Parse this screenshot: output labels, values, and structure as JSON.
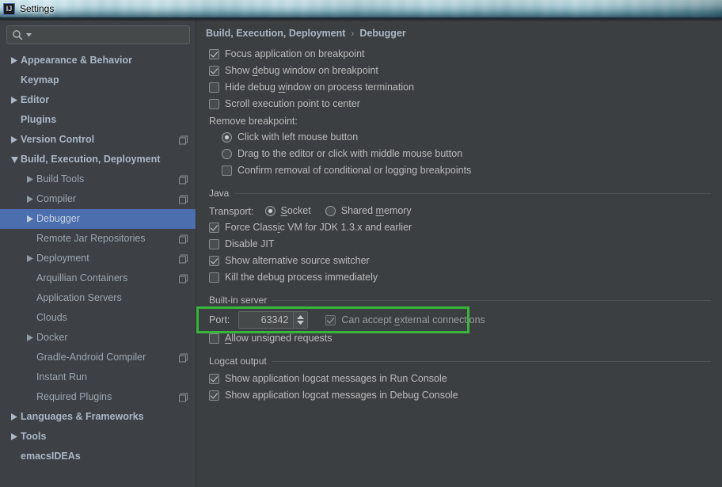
{
  "window": {
    "title": "Settings",
    "app_icon": "IJ",
    "icon_name": "intellij-idea-icon"
  },
  "sidebar": {
    "search": {
      "value": "",
      "placeholder": "",
      "icon": "search-icon",
      "dropdown_icon": "chevron-down-icon"
    },
    "items": [
      {
        "label": "Appearance & Behavior",
        "level": 0,
        "arrow": "right",
        "scope_icon": false,
        "selected": false
      },
      {
        "label": "Keymap",
        "level": 0,
        "arrow": "none",
        "scope_icon": false,
        "selected": false
      },
      {
        "label": "Editor",
        "level": 0,
        "arrow": "right",
        "scope_icon": false,
        "selected": false
      },
      {
        "label": "Plugins",
        "level": 0,
        "arrow": "none",
        "scope_icon": false,
        "selected": false
      },
      {
        "label": "Version Control",
        "level": 0,
        "arrow": "right",
        "scope_icon": true,
        "selected": false
      },
      {
        "label": "Build, Execution, Deployment",
        "level": 0,
        "arrow": "down",
        "scope_icon": false,
        "selected": false
      },
      {
        "label": "Build Tools",
        "level": 1,
        "arrow": "right",
        "scope_icon": true,
        "selected": false
      },
      {
        "label": "Compiler",
        "level": 1,
        "arrow": "right",
        "scope_icon": true,
        "selected": false
      },
      {
        "label": "Debugger",
        "level": 1,
        "arrow": "right",
        "scope_icon": false,
        "selected": true
      },
      {
        "label": "Remote Jar Repositories",
        "level": 1,
        "arrow": "none",
        "scope_icon": true,
        "selected": false
      },
      {
        "label": "Deployment",
        "level": 1,
        "arrow": "right",
        "scope_icon": true,
        "selected": false
      },
      {
        "label": "Arquillian Containers",
        "level": 1,
        "arrow": "none",
        "scope_icon": true,
        "selected": false
      },
      {
        "label": "Application Servers",
        "level": 1,
        "arrow": "none",
        "scope_icon": false,
        "selected": false
      },
      {
        "label": "Clouds",
        "level": 1,
        "arrow": "none",
        "scope_icon": false,
        "selected": false
      },
      {
        "label": "Docker",
        "level": 1,
        "arrow": "right",
        "scope_icon": false,
        "selected": false
      },
      {
        "label": "Gradle-Android Compiler",
        "level": 1,
        "arrow": "none",
        "scope_icon": true,
        "selected": false
      },
      {
        "label": "Instant Run",
        "level": 1,
        "arrow": "none",
        "scope_icon": false,
        "selected": false
      },
      {
        "label": "Required Plugins",
        "level": 1,
        "arrow": "none",
        "scope_icon": true,
        "selected": false
      },
      {
        "label": "Languages & Frameworks",
        "level": 0,
        "arrow": "right",
        "scope_icon": false,
        "selected": false
      },
      {
        "label": "Tools",
        "level": 0,
        "arrow": "right",
        "scope_icon": false,
        "selected": false
      },
      {
        "label": "emacsIDEAs",
        "level": 0,
        "arrow": "none",
        "scope_icon": false,
        "selected": false
      }
    ]
  },
  "main": {
    "breadcrumb": {
      "parent": "Build, Execution, Deployment",
      "separator": "›",
      "current": "Debugger"
    },
    "top_options": [
      {
        "label": "Focus application on breakpoint",
        "checked": true,
        "mnemonic": ""
      },
      {
        "label": "Show debug window on breakpoint",
        "checked": true,
        "mnemonic": "d"
      },
      {
        "label": "Hide debug window on process termination",
        "checked": false,
        "mnemonic": "w"
      },
      {
        "label": "Scroll execution point to center",
        "checked": false,
        "mnemonic": ""
      }
    ],
    "remove_breakpoint": {
      "title": "Remove breakpoint:",
      "radios": [
        {
          "label": "Click with left mouse button",
          "selected": true
        },
        {
          "label": "Drag to the editor or click with middle mouse button",
          "selected": false
        }
      ],
      "confirm": {
        "label": "Confirm removal of conditional or logging breakpoints",
        "checked": false
      }
    },
    "java": {
      "section_title": "Java",
      "transport": {
        "label": "Transport:",
        "options": [
          {
            "label": "Socket",
            "selected": true,
            "mnemonic": "S"
          },
          {
            "label": "Shared memory",
            "selected": false,
            "mnemonic": "m"
          }
        ]
      },
      "options": [
        {
          "label": "Force Classic VM for JDK 1.3.x and earlier",
          "checked": true,
          "mnemonic": "i"
        },
        {
          "label": "Disable JIT",
          "checked": false,
          "mnemonic": ""
        },
        {
          "label": "Show alternative source switcher",
          "checked": true,
          "mnemonic": ""
        },
        {
          "label": "Kill the debug process immediately",
          "checked": false,
          "mnemonic": ""
        }
      ]
    },
    "builtin_server": {
      "section_title": "Built-in server",
      "port_label": "Port:",
      "port_value": "63342",
      "spinner_up_icon": "spinner-up-icon",
      "spinner_down_icon": "spinner-down-icon",
      "external_connections": {
        "label": "Can accept external connections",
        "checked": true,
        "mnemonic": "e",
        "disabled": true
      },
      "allow_unsigned": {
        "label": "Allow unsigned requests",
        "checked": false,
        "mnemonic": "A"
      }
    },
    "logcat": {
      "section_title": "Logcat output",
      "options": [
        {
          "label": "Show application logcat messages in Run Console",
          "checked": true
        },
        {
          "label": "Show application logcat messages in Debug Console",
          "checked": true
        }
      ]
    }
  },
  "annotation": {
    "highlight_color": "#38b53a",
    "shape": "rectangle",
    "targets": [
      "port-field",
      "can-accept-external-connections-checkbox"
    ]
  },
  "colors": {
    "selection_blue": "#4b6eaf",
    "panel_bg": "#3c3f41",
    "sidebar_bg": "#3d4045",
    "text": "#bbbbbb",
    "tree_text": "#a9b7c6"
  }
}
